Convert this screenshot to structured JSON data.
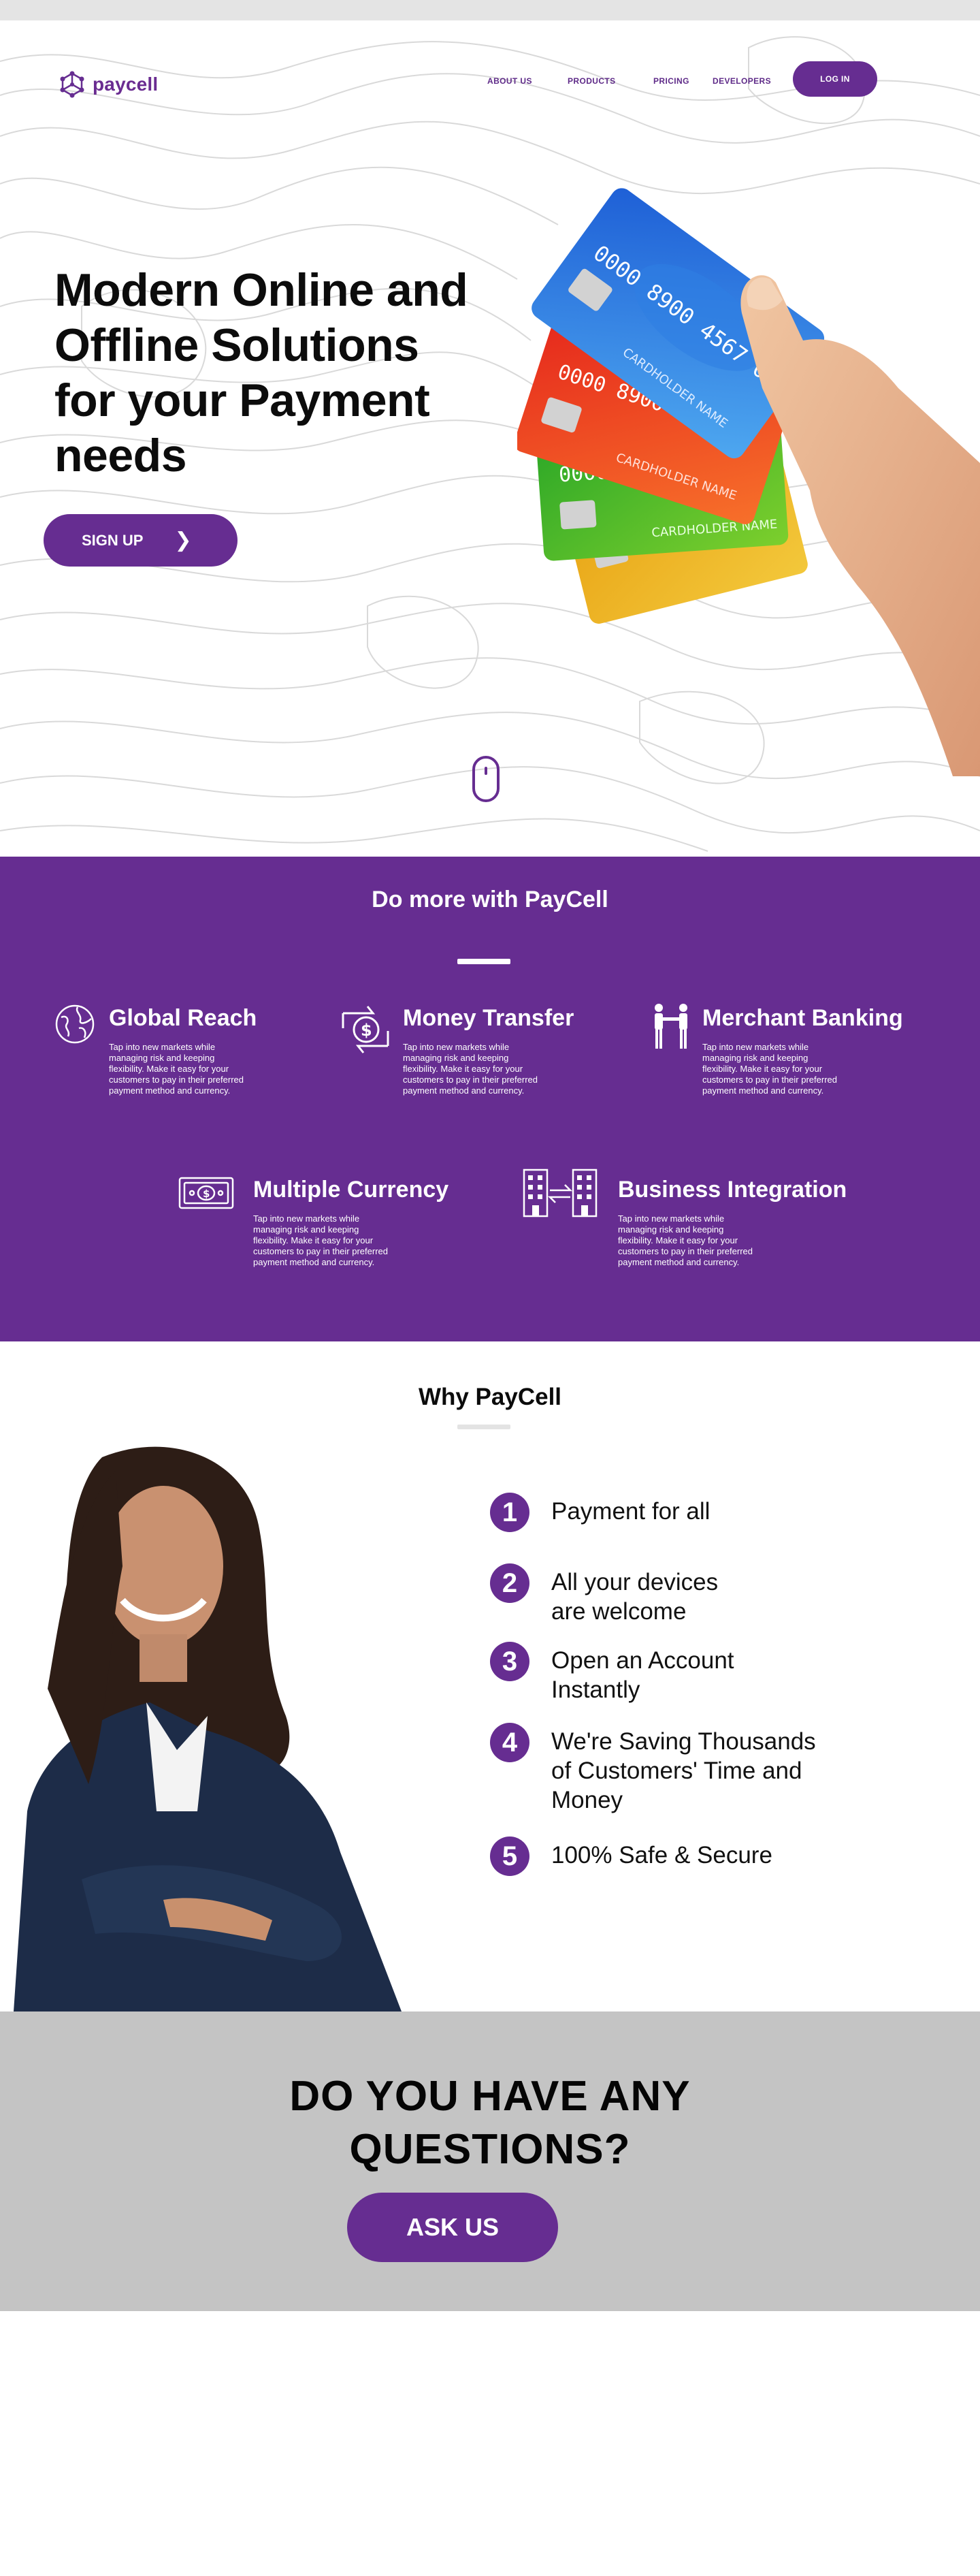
{
  "brand": {
    "name": "paycell",
    "accent": "#662d91",
    "logo_icon": "hexagon-network-icon"
  },
  "nav": {
    "links": [
      "ABOUT US",
      "PRODUCTS",
      "PRICING",
      "DEVELOPERS"
    ],
    "login_label": "LOG IN"
  },
  "hero": {
    "title": "Modern Online and Offline Solutions for your Payment needs",
    "signup_label": "SIGN UP",
    "signup_icon": "chevron-right-icon",
    "image": "hand-holding-credit-cards",
    "cards": [
      "blue card 0123 4567 8900 CARDHOLDER NAME",
      "red card",
      "green card",
      "gold card"
    ],
    "scroll_icon": "mouse-scroll-icon"
  },
  "features": {
    "title": "Do more with PayCell",
    "items": [
      {
        "title": "Global Reach",
        "icon": "globe-icon",
        "desc": "Tap into new markets while managing risk and keeping flexibility. Make it easy for your customers to pay in their preferred payment method and currency."
      },
      {
        "title": "Money Transfer",
        "icon": "money-transfer-icon",
        "desc": "Tap into new markets while managing risk and keeping flexibility. Make it easy for your customers to pay in their preferred payment method and currency."
      },
      {
        "title": "Merchant Banking",
        "icon": "handshake-icon",
        "desc": "Tap into new markets while managing risk and keeping flexibility. Make it easy for your customers to pay in their preferred payment method and currency."
      },
      {
        "title": "Multiple Currency",
        "icon": "banknote-icon",
        "desc": "Tap into new markets while managing risk and keeping flexibility. Make it easy for your customers to pay in their preferred payment method and currency."
      },
      {
        "title": "Business Integration",
        "icon": "buildings-exchange-icon",
        "desc": "Tap into new markets while managing risk and keeping flexibility. Make it easy for your customers to pay in their preferred payment method and currency."
      }
    ]
  },
  "why": {
    "title": "Why PayCell",
    "image": "smiling-businesswoman-arms-crossed",
    "items": [
      {
        "num": "1",
        "text": "Payment for all"
      },
      {
        "num": "2",
        "text": "All your devices are welcome"
      },
      {
        "num": "3",
        "text": "Open an Account Instantly"
      },
      {
        "num": "4",
        "text": "We're Saving Thousands of Customers' Time and Money"
      },
      {
        "num": "5",
        "text": "100% Safe & Secure"
      }
    ]
  },
  "cta": {
    "title": "DO YOU HAVE ANY QUESTIONS?",
    "button_label": "ASK US"
  }
}
